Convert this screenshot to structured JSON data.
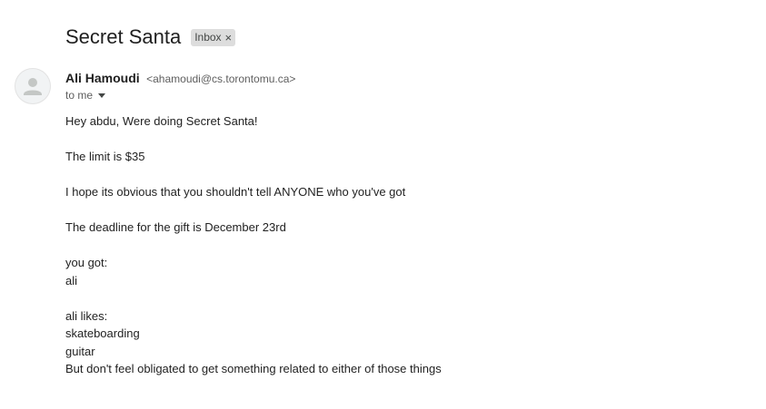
{
  "email": {
    "subject": "Secret Santa",
    "label": "Inbox",
    "label_remove": "×",
    "sender_name": "Ali Hamoudi",
    "sender_email": "<ahamoudi@cs.torontomu.ca>",
    "recipient": "to me",
    "body_lines": [
      "Hey abdu, Were doing Secret Santa!",
      "",
      "The limit is $35",
      "",
      "I hope its obvious that you shouldn't tell ANYONE who you've got",
      "",
      "The deadline for the gift is December 23rd",
      "",
      "you got:",
      "ali",
      "",
      "ali likes:",
      "skateboarding",
      "guitar",
      "But don't feel obligated to get something related to either of those things"
    ]
  }
}
